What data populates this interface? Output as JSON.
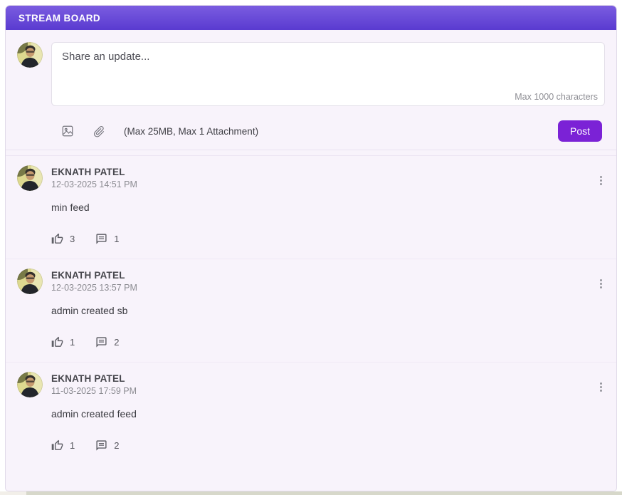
{
  "header": {
    "title": "STREAM BOARD"
  },
  "composer": {
    "placeholder": "Share an update...",
    "max_chars_hint": "Max 1000 characters",
    "attachment_hint": "(Max 25MB, Max 1 Attachment)",
    "post_label": "Post"
  },
  "posts": [
    {
      "author": "EKNATH PATEL",
      "timestamp": "12-03-2025 14:51 PM",
      "content": "min feed",
      "likes": "3",
      "comments": "1"
    },
    {
      "author": "EKNATH PATEL",
      "timestamp": "12-03-2025 13:57 PM",
      "content": "admin created sb",
      "likes": "1",
      "comments": "2"
    },
    {
      "author": "EKNATH PATEL",
      "timestamp": "11-03-2025 17:59 PM",
      "content": "admin created feed",
      "likes": "1",
      "comments": "2"
    }
  ],
  "colors": {
    "header_gradient_top": "#7a5ce0",
    "header_gradient_bottom": "#5a3bd0",
    "post_button": "#7b22d6",
    "board_bg": "#f8f3fb"
  }
}
